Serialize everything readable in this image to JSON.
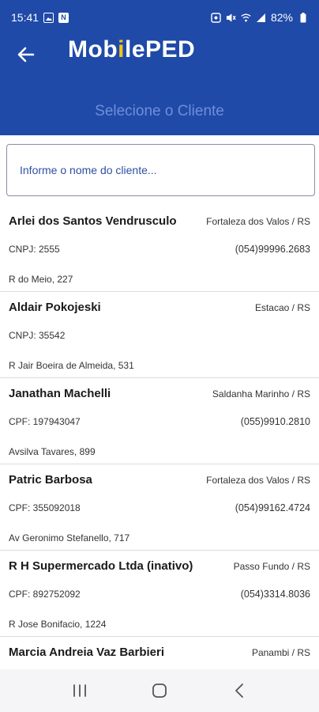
{
  "status_bar": {
    "time": "15:41",
    "battery": "82%"
  },
  "header": {
    "title_pre": "Mob",
    "title_accent": "i",
    "title_post": "lePED",
    "subtitle": "Selecione o Cliente"
  },
  "search": {
    "placeholder": "Informe o nome do cliente..."
  },
  "clients": [
    {
      "name": "Arlei dos Santos Vendrusculo",
      "city": "Fortaleza dos Valos / RS",
      "doc": "CNPJ: 2555",
      "phone": "(054)99996.2683",
      "address": "R do Meio, 227"
    },
    {
      "name": "Aldair Pokojeski",
      "city": "Estacao / RS",
      "doc": "CNPJ: 35542",
      "phone": "",
      "address": "R Jair Boeira de Almeida, 531"
    },
    {
      "name": "Janathan Machelli",
      "city": "Saldanha Marinho / RS",
      "doc": "CPF: 197943047",
      "phone": "(055)9910.2810",
      "address": "Avsilva Tavares, 899"
    },
    {
      "name": "Patric Barbosa",
      "city": "Fortaleza dos Valos / RS",
      "doc": "CPF: 355092018",
      "phone": "(054)99162.4724",
      "address": "Av Geronimo Stefanello, 717"
    },
    {
      "name": "R H Supermercado Ltda (inativo)",
      "city": "Passo Fundo / RS",
      "doc": "CPF: 892752092",
      "phone": "(054)3314.8036",
      "address": "R Jose Bonifacio, 1224"
    },
    {
      "name": "Marcia Andreia Vaz Barbieri",
      "city": "Panambi / RS",
      "doc": "",
      "phone": "",
      "address": ""
    }
  ],
  "icons": {
    "back": "arrow-left-icon",
    "nav_recent": "recent-apps-icon",
    "nav_home": "home-icon",
    "nav_back": "nav-back-icon"
  },
  "colors": {
    "primary": "#1f4aa8",
    "subtitle": "#6f8fd8",
    "accent": "#f5c518"
  }
}
